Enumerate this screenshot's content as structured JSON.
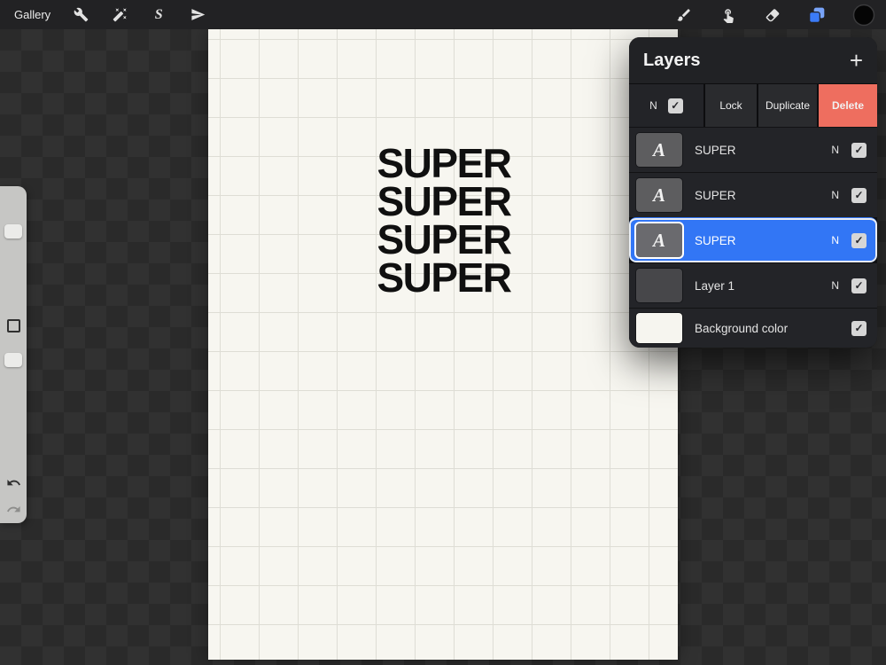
{
  "ui": {
    "check": "✓"
  },
  "toolbar": {
    "gallery_label": "Gallery",
    "selection_glyph": "S",
    "icon_color": "#e2e2e2",
    "layers_active_color": "#3b7bf7",
    "color_swatch_color": "#050505"
  },
  "canvas": {
    "text_lines": [
      "SUPER",
      "SUPER",
      "SUPER",
      "SUPER"
    ]
  },
  "layers_panel": {
    "title": "Layers",
    "add_button": "+",
    "swipe_row": {
      "blend": "N",
      "lock_label": "Lock",
      "duplicate_label": "Duplicate",
      "delete_label": "Delete",
      "delete_color": "#ee6e5f"
    },
    "selected_color": "#3276f5",
    "layers": [
      {
        "name": "SUPER",
        "blend": "N",
        "thumb_glyph": "A",
        "visible": true,
        "selected": false
      },
      {
        "name": "SUPER",
        "blend": "N",
        "thumb_glyph": "A",
        "visible": true,
        "selected": false
      },
      {
        "name": "SUPER",
        "blend": "N",
        "thumb_glyph": "A",
        "visible": true,
        "selected": true
      },
      {
        "name": "Layer 1",
        "blend": "N",
        "thumb_glyph": "",
        "visible": true,
        "selected": false
      },
      {
        "name": "Background color",
        "blend": "",
        "thumb_glyph": "",
        "visible": true,
        "selected": false
      }
    ]
  }
}
